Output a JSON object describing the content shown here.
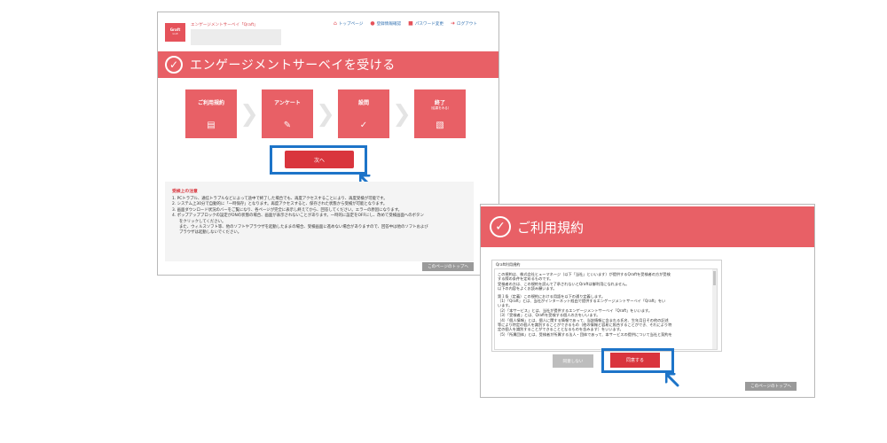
{
  "window1": {
    "logo": {
      "name": "Graft",
      "sub": "Graft"
    },
    "site_title": "エンゲージメントサーベイ「Qraft」",
    "nav": [
      {
        "icon": "home-icon",
        "label": "トップページ"
      },
      {
        "icon": "person-icon",
        "label": "登録情報確認"
      },
      {
        "icon": "lock-icon",
        "label": "パスワード変更"
      },
      {
        "icon": "logout-icon",
        "label": "ログアウト"
      }
    ],
    "page_title": "エンゲージメントサーベイを受ける",
    "steps": [
      {
        "label": "ご利用規約",
        "sub": "",
        "icon": "document-icon"
      },
      {
        "label": "アンケート",
        "sub": "",
        "icon": "pencil-icon"
      },
      {
        "label": "設問",
        "sub": "",
        "icon": "checkmark-icon"
      },
      {
        "label": "終了",
        "sub": "（結果をみる）",
        "icon": "report-icon"
      }
    ],
    "next_button": "次へ",
    "notice_title": "受検上の注意",
    "notice_lines": [
      "1. PCトラブル、通信トラブルなどによって途中で終了した場合でも、再度アクセスすることにより、再度受検が可能です。",
      "2. システム上30分で自動的に「一時保存」となります。再度アクセスすると、保存された状態から受検が可能となります。",
      "3. 画面ダウンロード状況のバーをご覧になり、各ページが完全に表示し終えてから、回答してください。エラーの原因になります。",
      "4. ポップアップブロックの設定がONの状態の場合、画面が表示されないことがあります。一時的に設定をOFFにし、改めて受検画面へのボタン",
      "をクリックしてください。",
      "また、ウィルスソフト等、他のソフトやブラウザを起動したままの場合、受検画面に進めない場合がありますので、回答中は他のソフトおよび",
      "ブラウザは起動しないでください。"
    ],
    "top_button": "このページのトップへ"
  },
  "window2": {
    "page_title": "ご利用規約",
    "terms_heading": "Qraft利用規約",
    "terms_lines": [
      "この規約は、株式会社ヒューマネージ（以下「当社」といいます）が提供するQraftを受検者の方が受検",
      "する際の条件を定めるものです。",
      "受検者の方は、この規約を読んで了承されないとQraftは御利用になれません。",
      "以下の内容をよくお読み願います。",
      "第１条（定義）この規約における用語を以下の通り定義します。",
      "（1）「Qraft」とは、当社がインターネット経由で提供するエンゲージメントサーベイ「Qraft」をい",
      "います。",
      "（2）「本サービス」とは、当社が提供するエンゲージメントサーベイ「Qraft」をいいます。",
      "（3）「受検者」とは、Qraftを受検する個人の方をいいます。",
      "（4）「個人情報」とは、個人に関する情報であって、当該情報に含まれる氏名、生年月日その他の記述",
      "等により特定の個人を識別することができるもの（他の情報と容易に照合することができ、それにより特",
      "定の個人を識別することができることとなるものを含みます）をいいます。",
      "（5）「所属団体」とは、受検者が所属する法人・団体であって、本サービスの提供について当社と契約を"
    ],
    "disagree_button": "同意しない",
    "agree_button": "同意する",
    "top_button": "このページのトップへ"
  },
  "colors": {
    "accent": "#e86066",
    "button_red": "#d9353d",
    "highlight": "#1d74c8",
    "link": "#2f6fb0"
  }
}
